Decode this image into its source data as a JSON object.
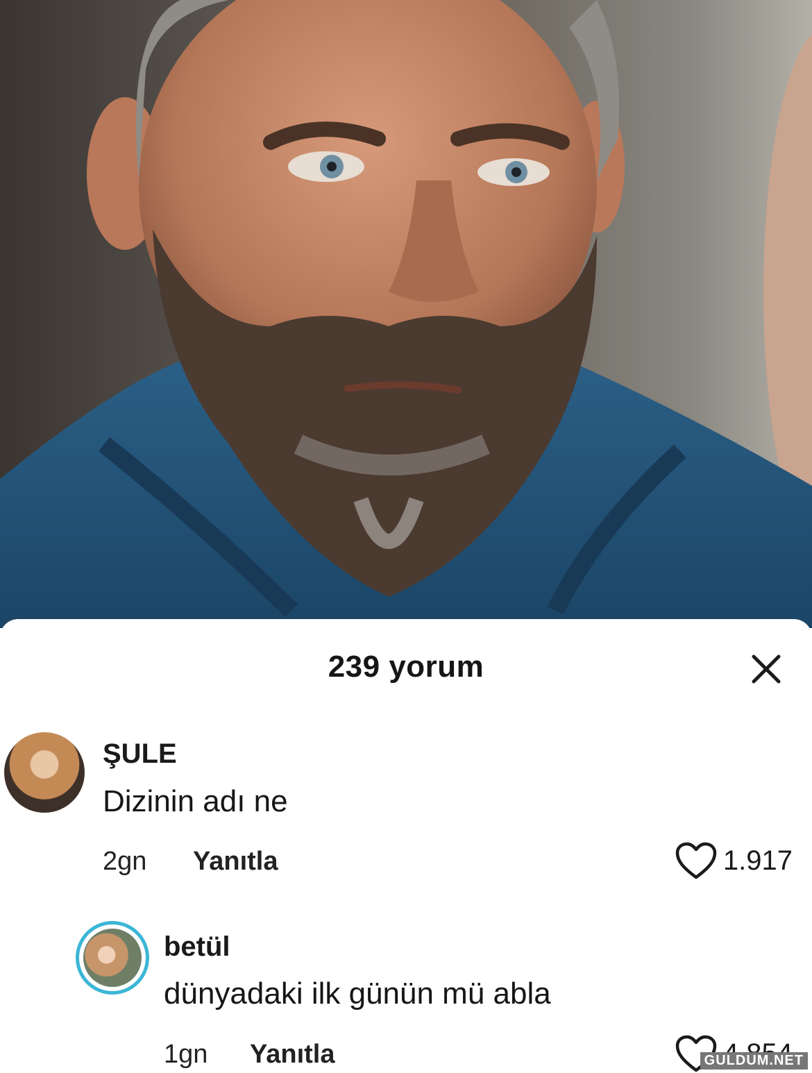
{
  "header": {
    "title": "239 yorum"
  },
  "comments": [
    {
      "username": "ŞULE",
      "text": "Dizinin adı ne",
      "time": "2gn",
      "reply_label": "Yanıtla",
      "likes": "1.917"
    },
    {
      "username": "betül",
      "text": "dünyadaki ilk günün mü abla",
      "time": "1gn",
      "reply_label": "Yanıtla",
      "likes": "4.854"
    }
  ],
  "watermark": "GULDUM.NET",
  "icons": {
    "close": "close-icon",
    "like": "heart-outline-icon"
  },
  "colors": {
    "story_ring": "#3bb6d6",
    "sheet_bg": "#ffffff",
    "text": "#161616"
  }
}
